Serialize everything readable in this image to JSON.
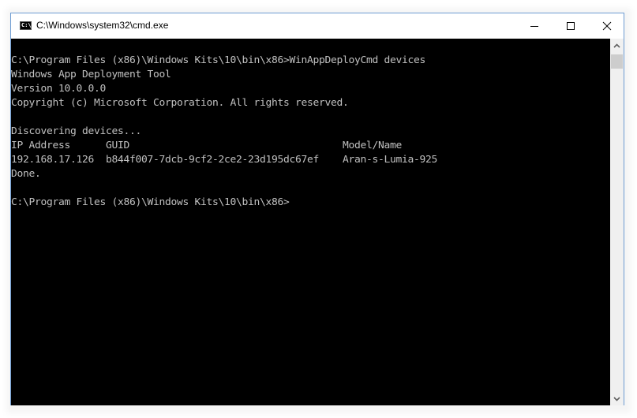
{
  "window": {
    "title": "C:\\Windows\\system32\\cmd.exe",
    "icon": "cmd-icon",
    "icon_text": "C:\\_",
    "controls": [
      "minimize-icon",
      "maximize-icon",
      "close-icon"
    ]
  },
  "console": {
    "background": "#000000",
    "foreground": "#c0c0c0",
    "lines": [
      "C:\\Program Files (x86)\\Windows Kits\\10\\bin\\x86>WinAppDeployCmd devices",
      "Windows App Deployment Tool",
      "Version 10.0.0.0",
      "Copyright (c) Microsoft Corporation. All rights reserved.",
      "",
      "Discovering devices...",
      "IP Address      GUID                                    Model/Name",
      "192.168.17.126  b844f007-7dcb-9cf2-2ce2-23d195dc67ef    Aran-s-Lumia-925",
      "Done.",
      "",
      "C:\\Program Files (x86)\\Windows Kits\\10\\bin\\x86>"
    ]
  },
  "scrollbar": {
    "up_icon": "chevron-up-icon",
    "down_icon": "chevron-down-icon"
  }
}
